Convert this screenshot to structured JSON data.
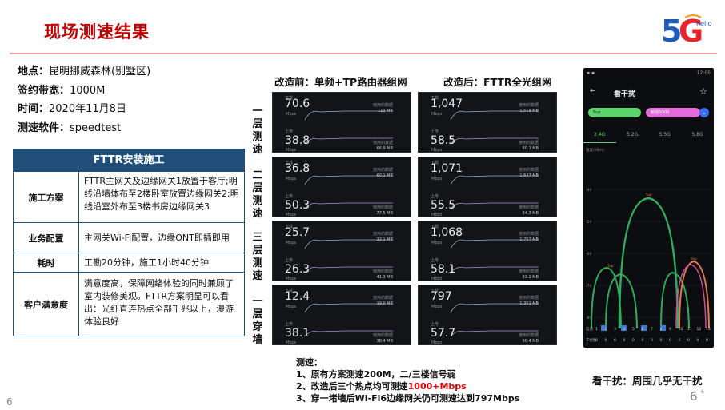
{
  "title": "现场测速结果",
  "page_number": "6",
  "page_number_small": "6",
  "corner_mark": "6",
  "logo": {
    "big": "5G",
    "small": "hello",
    "colors": {
      "blue": "#1e5bb8",
      "red": "#e5262c",
      "orange": "#f39a1e"
    }
  },
  "info": [
    {
      "key": "地点：",
      "value": "昆明挪威森林(别墅区)"
    },
    {
      "key": "签约带宽：",
      "value": "1000M"
    },
    {
      "key": "时间：",
      "value": "2020年11月8日"
    },
    {
      "key": "测速软件：",
      "value": "speedtest"
    }
  ],
  "fttr_table": {
    "header": "FTTR安装施工",
    "rows": [
      {
        "label": "施工方案",
        "text": "FTTR主网关及边缘网关1放置于客厅;明线沿墙体布至2楼卧室放置边缘网关2;明线沿室外布至3楼书房边缘网关3"
      },
      {
        "label": "业务配置",
        "text": "主网关Wi-Fi配置，边缘ONT即插即用"
      },
      {
        "label": "耗时",
        "text": "工勘20分钟，施工1小时40分钟"
      },
      {
        "label": "客户满意度",
        "text": "满意度高，保障网络体验的同时兼顾了室内装修美观。FTTR方案明显可以看出：光纤直连热点全部千兆以上，漫游体验良好"
      }
    ]
  },
  "before_title": "改造前：单频+TP路由器组网",
  "after_title": "改造后：FTTR全光组网",
  "floors": [
    "一层测速",
    "二层测速",
    "三层测速",
    "一层穿墙"
  ],
  "panel_labels": {
    "down": "下载",
    "up": "上传",
    "unit": "Mbps",
    "used": "使用的数据"
  },
  "speed_panels": {
    "before": [
      {
        "down": "70.6",
        "up": "38.8",
        "down_used": "111 MB",
        "up_used": "66.9 MB"
      },
      {
        "down": "36.8",
        "up": "50.3",
        "down_used": "60.1 MB",
        "up_used": "77.5 MB"
      },
      {
        "down": "25.7",
        "up": "26.3",
        "down_used": "22.1 MB",
        "up_used": "41.3 MB"
      },
      {
        "down": "12.4",
        "up": "38.1",
        "down_used": "19.0 MB",
        "up_used": "38.4 MB"
      }
    ],
    "after": [
      {
        "down": "1,047",
        "up": "58.5",
        "down_used": "1,519 MB",
        "up_used": "80.1 MB"
      },
      {
        "down": "1,071",
        "up": "55.5",
        "down_used": "1,647 MB",
        "up_used": "84.3 MB"
      },
      {
        "down": "1,068",
        "up": "58.1",
        "down_used": "1,757 MB",
        "up_used": "83.1 MB"
      },
      {
        "down": "797",
        "up": "57.7",
        "down_used": "1,301 MB",
        "up_used": "90.4 MB"
      }
    ]
  },
  "phone": {
    "time": "12:05",
    "title": "看干扰",
    "pill_left": "5up",
    "pill_right": "勉强5G00",
    "tabs": [
      "2.4G",
      "5.2G",
      "5.5G",
      "5.8G"
    ],
    "yaxis_label": "强度(dBm)",
    "yticks": [
      "-40",
      "-50",
      "-60",
      "-70",
      "-80",
      "-90"
    ],
    "xticks": [
      "1",
      "2",
      "3",
      "4",
      "5",
      "6",
      "7",
      "8",
      "9",
      "10",
      "11",
      "12",
      "13"
    ],
    "row_labels": [
      "信道",
      "干扰数"
    ],
    "counts": [
      "0",
      "0",
      "0",
      "0",
      "0",
      "0",
      "0",
      "0",
      "0",
      "0",
      "0",
      "0",
      "0"
    ]
  },
  "notes": {
    "heading": "测速：",
    "line1": "1、原有方案测速200M，二/三楼信号弱",
    "line2_prefix": "2、改造后三个热点均可测速",
    "line2_highlight": "1000+Mbps",
    "line3": "3、穿一堵墙后Wi-Fi6边缘网关仍可测速达到797Mbps"
  },
  "interference_note": "看干扰：周围几乎无干扰"
}
